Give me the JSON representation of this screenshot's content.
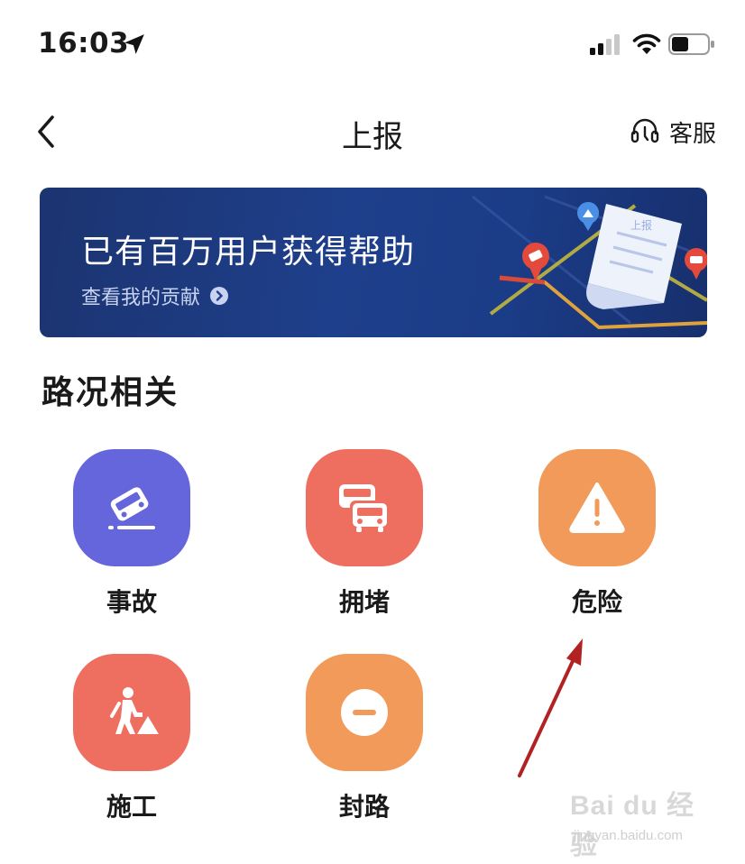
{
  "status_bar": {
    "time": "16:03"
  },
  "nav": {
    "title": "上报",
    "service_label": "客服"
  },
  "banner": {
    "title": "已有百万用户获得帮助",
    "link_text": "查看我的贡献",
    "doc_text": "上报"
  },
  "section": {
    "title": "路况相关"
  },
  "items": [
    {
      "label": "事故",
      "icon": "car-accident-icon",
      "color": "#6566dc"
    },
    {
      "label": "拥堵",
      "icon": "traffic-jam-icon",
      "color": "#ee6e5f"
    },
    {
      "label": "危险",
      "icon": "warning-icon",
      "color": "#f19a5a"
    },
    {
      "label": "施工",
      "icon": "construction-icon",
      "color": "#ee6e5f"
    },
    {
      "label": "封路",
      "icon": "road-closed-icon",
      "color": "#f19a5a"
    }
  ],
  "watermark": {
    "brand": "Bai du 经验",
    "url": "jingyan.baidu.com"
  }
}
